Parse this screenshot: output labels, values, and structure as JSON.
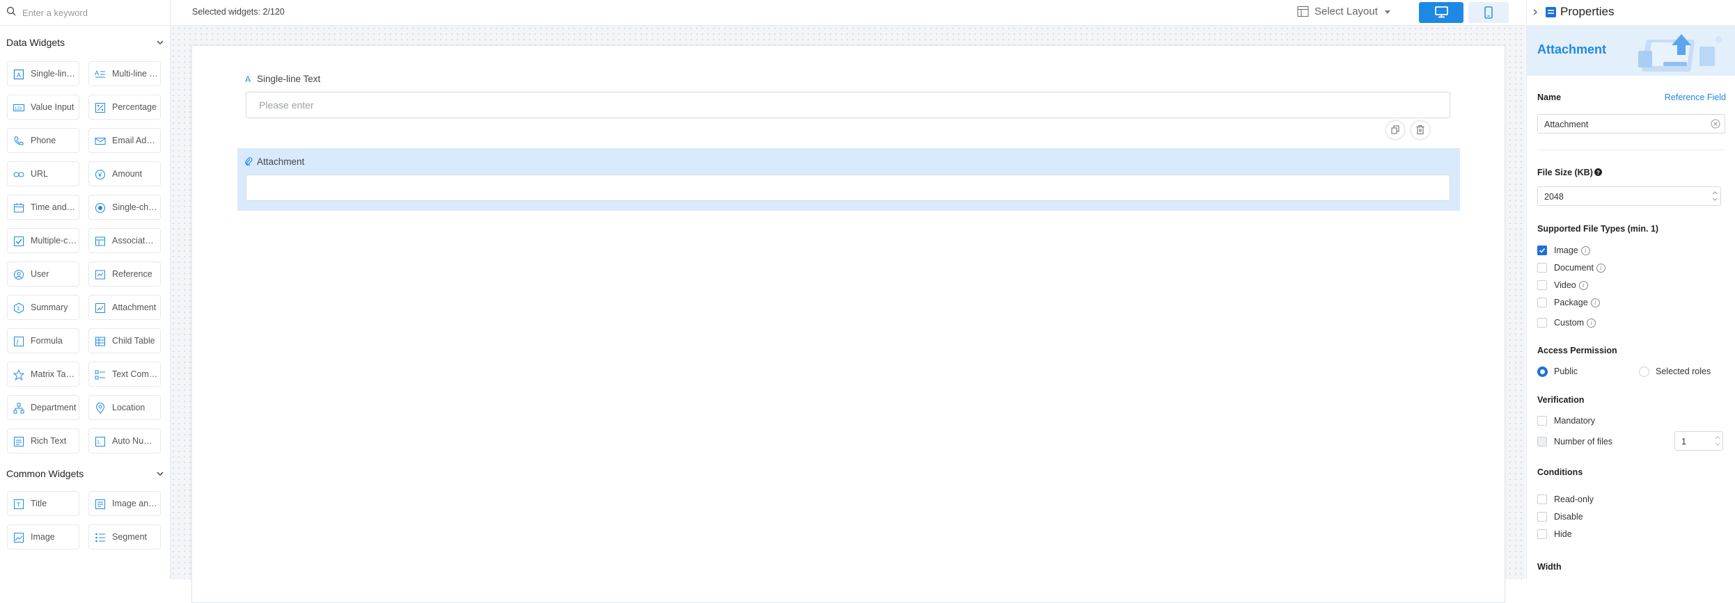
{
  "search": {
    "placeholder": "Enter a keyword",
    "icon": "search-icon"
  },
  "left": {
    "data_widgets_title": "Data Widgets",
    "common_widgets_title": "Common Widgets",
    "data_widgets": [
      {
        "label": "Single-line Text",
        "icon": "text-icon"
      },
      {
        "label": "Multi-line Text",
        "icon": "multiline-icon"
      },
      {
        "label": "Value Input",
        "icon": "number-icon"
      },
      {
        "label": "Percentage",
        "icon": "percentage-icon"
      },
      {
        "label": "Phone",
        "icon": "phone-icon"
      },
      {
        "label": "Email Address",
        "icon": "email-icon"
      },
      {
        "label": "URL",
        "icon": "link-icon"
      },
      {
        "label": "Amount",
        "icon": "amount-icon"
      },
      {
        "label": "Time and Date",
        "icon": "calendar-icon"
      },
      {
        "label": "Single-choice",
        "icon": "radio-icon"
      },
      {
        "label": "Multiple-choice",
        "icon": "checkbox-icon"
      },
      {
        "label": "Associated Form",
        "icon": "associate-icon"
      },
      {
        "label": "User",
        "icon": "user-icon"
      },
      {
        "label": "Reference",
        "icon": "reference-icon"
      },
      {
        "label": "Summary",
        "icon": "summary-icon"
      },
      {
        "label": "Attachment",
        "icon": "attachment-icon"
      },
      {
        "label": "Formula",
        "icon": "formula-icon"
      },
      {
        "label": "Child Table",
        "icon": "table-icon"
      },
      {
        "label": "Matrix Table",
        "icon": "matrix-icon"
      },
      {
        "label": "Text Combination",
        "icon": "text-combination-icon"
      },
      {
        "label": "Department",
        "icon": "department-icon"
      },
      {
        "label": "Location",
        "icon": "location-icon"
      },
      {
        "label": "Rich Text",
        "icon": "rich-text-icon"
      },
      {
        "label": "Auto Number",
        "icon": "auto-number-icon"
      }
    ],
    "common_widgets": [
      {
        "label": "Title",
        "icon": "title-icon"
      },
      {
        "label": "Image and Text",
        "icon": "image-text-icon"
      },
      {
        "label": "Image",
        "icon": "image-icon"
      },
      {
        "label": "Segment",
        "icon": "segment-icon"
      }
    ]
  },
  "topbar": {
    "selected_count": "Selected widgets: 2/120",
    "layout_label": "Select Layout",
    "desktop_icon": "desktop-icon",
    "mobile_icon": "mobile-icon"
  },
  "form": {
    "field1": {
      "label": "Single-line Text",
      "placeholder": "Please enter"
    },
    "field2": {
      "label": "Attachment"
    }
  },
  "properties": {
    "title": "Properties",
    "banner_title": "Attachment",
    "name_label": "Name",
    "reference_link": "Reference Field",
    "name_value": "Attachment",
    "file_size_label": "File Size (KB)",
    "file_size_value": "2048",
    "file_types_label": "Supported File Types (min. 1)",
    "file_types": [
      {
        "label": "Image",
        "checked": true
      },
      {
        "label": "Document",
        "checked": false
      },
      {
        "label": "Video",
        "checked": false
      },
      {
        "label": "Package",
        "checked": false
      },
      {
        "label": "Custom",
        "checked": false
      }
    ],
    "access_label": "Access Permission",
    "access_public": "Public",
    "access_roles": "Selected roles",
    "verification_label": "Verification",
    "mandatory": "Mandatory",
    "num_files": "Number of files",
    "num_files_value": "1",
    "conditions_label": "Conditions",
    "read_only": "Read-only",
    "disable": "Disable",
    "hide": "Hide",
    "width_label": "Width"
  },
  "colors": {
    "accent": "#1e88e5",
    "selected_bg": "#d8eafb"
  }
}
